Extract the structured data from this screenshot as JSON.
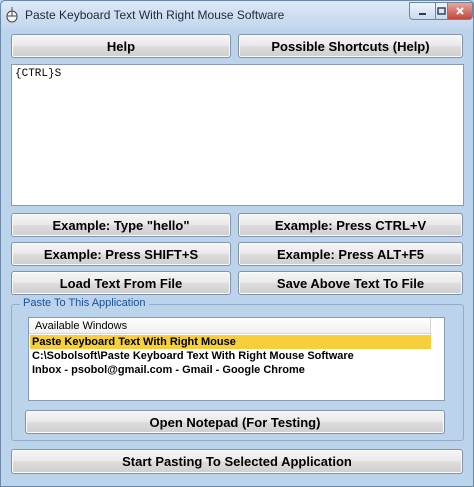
{
  "window": {
    "title": "Paste Keyboard Text With Right Mouse Software"
  },
  "buttons": {
    "help": "Help",
    "possible_shortcuts": "Possible Shortcuts (Help)",
    "example_hello": "Example: Type \"hello\"",
    "example_ctrl_v": "Example: Press CTRL+V",
    "example_shift_s": "Example: Press SHIFT+S",
    "example_alt_f5": "Example: Press ALT+F5",
    "load_text": "Load Text From File",
    "save_text": "Save Above Text To File",
    "open_notepad": "Open Notepad (For Testing)",
    "start_pasting": "Start Pasting To Selected Application"
  },
  "editor": {
    "text": "{CTRL}S"
  },
  "paste_group": {
    "label": "Paste To This Application",
    "column_header": "Available Windows",
    "items": [
      {
        "label": "Paste Keyboard Text With Right Mouse",
        "selected": true
      },
      {
        "label": "C:\\Sobolsoft\\Paste Keyboard Text With Right Mouse Software",
        "selected": false
      },
      {
        "label": "Inbox - psobol@gmail.com - Gmail - Google Chrome",
        "selected": false
      }
    ]
  },
  "colors": {
    "window_bg": "#bcd3ec",
    "selection": "#f7cf3c",
    "group_label": "#1b4f9a"
  }
}
